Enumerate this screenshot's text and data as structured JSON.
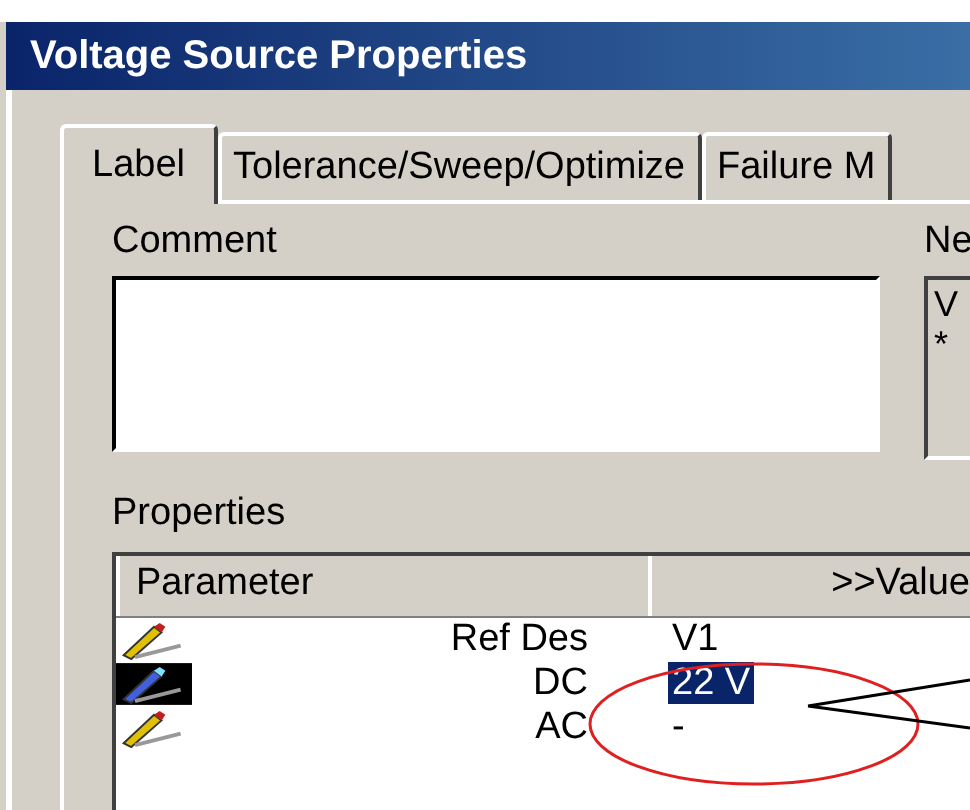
{
  "window": {
    "title": "Voltage Source Properties"
  },
  "tabs": [
    {
      "label": "Label",
      "selected": true
    },
    {
      "label": "Tolerance/Sweep/Optimize",
      "selected": false
    },
    {
      "label": "Failure M",
      "selected": false
    }
  ],
  "comment": {
    "label": "Comment"
  },
  "netlist": {
    "label": "Ne",
    "lines": [
      "V",
      "*"
    ]
  },
  "properties": {
    "label": "Properties",
    "columns": [
      "Parameter",
      ">>Value"
    ],
    "rows": [
      {
        "parameter": "Ref Des",
        "value": "V1",
        "selected": false
      },
      {
        "parameter": "DC",
        "value": "22 V",
        "selected": true
      },
      {
        "parameter": "AC",
        "value": "-",
        "selected": false
      }
    ]
  }
}
